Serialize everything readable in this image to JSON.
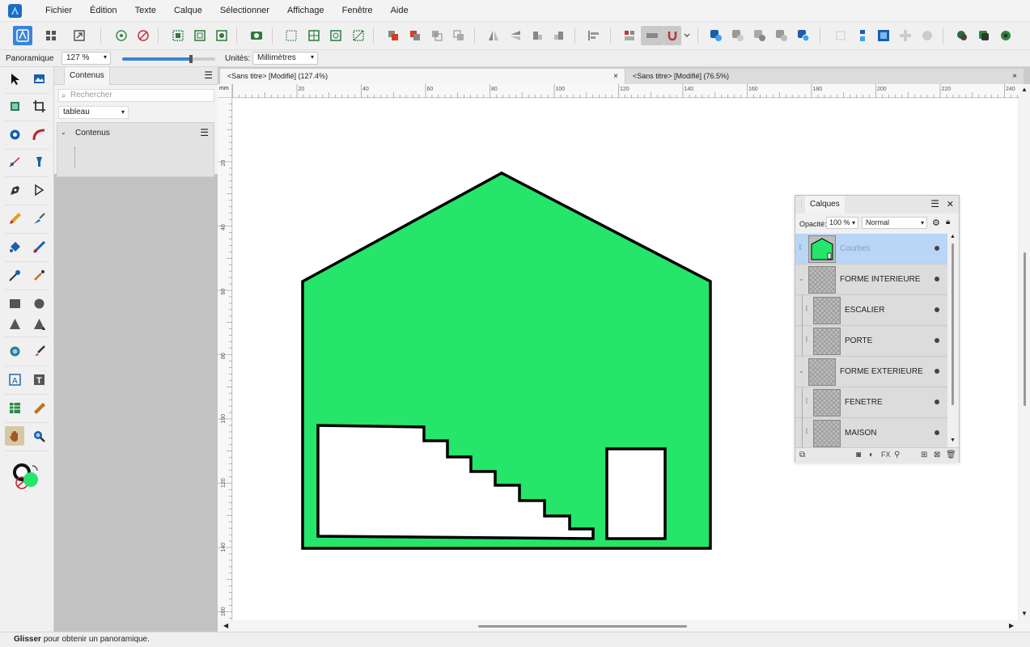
{
  "menu": [
    "Fichier",
    "Édition",
    "Texte",
    "Calque",
    "Sélectionner",
    "Affichage",
    "Fenêtre",
    "Aide"
  ],
  "context_bar": {
    "tool_name": "Panoramique",
    "zoom_value": "127 %",
    "zoom_slider_fraction": 0.74,
    "units_label": "Unités:",
    "units_value": "Millimètres"
  },
  "contents_panel": {
    "tab": "Contenus",
    "search_placeholder": "Rechercher",
    "filter_value": "tableau",
    "tree_root": "Contenus"
  },
  "document_tabs": [
    {
      "title": "<Sans titre> [Modifié] (127.4%)",
      "close": "×",
      "active": true
    },
    {
      "title": "<Sans titre> [Modifié] (76.5%)",
      "close": "×",
      "active": false
    }
  ],
  "ruler": {
    "unit": "mm",
    "h_labels": [
      "20",
      "40",
      "60",
      "80",
      "100",
      "120",
      "140",
      "160",
      "180",
      "200",
      "220",
      "240"
    ],
    "v_labels": [
      "20",
      "40",
      "60",
      "80",
      "100",
      "120",
      "140",
      "160"
    ]
  },
  "layers_panel": {
    "tab": "Calques",
    "opacity_label": "Opacité:",
    "opacity_value": "100 %",
    "blend_mode": "Normal",
    "layers": [
      {
        "name": "Courbes",
        "selected": true,
        "indent": 0,
        "expandable": false
      },
      {
        "name": "FORME INTERIEURE",
        "selected": false,
        "indent": 0,
        "expandable": true
      },
      {
        "name": "ESCALIER",
        "selected": false,
        "indent": 1,
        "expandable": false
      },
      {
        "name": "PORTE",
        "selected": false,
        "indent": 1,
        "expandable": false
      },
      {
        "name": "FORME EXTERIEURE",
        "selected": false,
        "indent": 0,
        "expandable": true
      },
      {
        "name": "FENETRE",
        "selected": false,
        "indent": 1,
        "expandable": false
      },
      {
        "name": "MAISON",
        "selected": false,
        "indent": 1,
        "expandable": false
      }
    ]
  },
  "status": {
    "bold": "Glisser",
    "text": " pour obtenir un panoramique."
  },
  "colors": {
    "accent": "#3a85d8",
    "house_fill": "#25e56a",
    "fill_swatch": "#25e56a",
    "selected_layer": "#b9d6f6"
  },
  "icons": {
    "toolbar": [
      "persona-designer-icon",
      "persona-pixel-icon",
      "persona-export-icon",
      "snapping-icon",
      "no-snapping-icon",
      "select-object-icon",
      "select-bounds-icon",
      "select-nodes-icon",
      "view-mode-icon",
      "align-icon",
      "boolean-add-icon",
      "boolean-subtract-icon",
      "arrange-front-icon",
      "arrange-back-icon",
      "flip-horizontal-icon",
      "flip-vertical-icon",
      "rotate-icon",
      "magnet-icon",
      "user-icon"
    ]
  }
}
